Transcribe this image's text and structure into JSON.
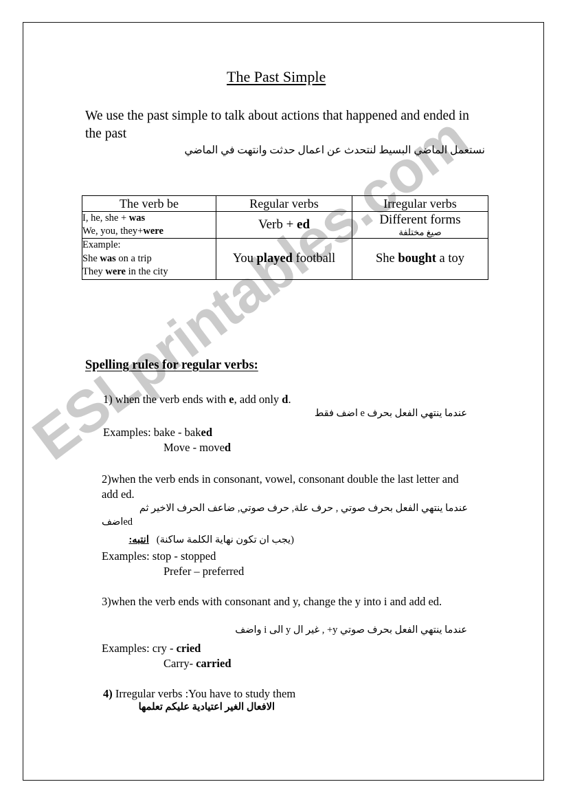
{
  "document": {
    "title": "The Past Simple",
    "intro_en": "We use the past simple to talk about actions that happened and ended in the past",
    "intro_ar": "نستعمل الماضي البسيط لنتحدث عن اعمال حدثت وانتهت في الماضي"
  },
  "watermark": {
    "text": "ESLprintables.com",
    "color": "#c9c9c9"
  },
  "table": {
    "headers": {
      "col1": "The verb be",
      "col2": "Regular verbs",
      "col3": "Irregular verbs"
    },
    "row_forms": {
      "col1_line1_plain": "I, he, she + ",
      "col1_line1_bold": "was",
      "col1_line2_plain": "We, you, they+",
      "col1_line2_bold": "were",
      "col2_plain": "Verb + ",
      "col2_bold": "ed",
      "col3_en": "Different forms",
      "col3_ar": "صيغ مختلفة"
    },
    "row_examples": {
      "col1_label": "Example:",
      "col1_line1_a": "She ",
      "col1_line1_bold": "was",
      "col1_line1_b": " on a trip",
      "col1_line2_a": "They ",
      "col1_line2_bold": "were",
      "col1_line2_b": " in the city",
      "col2_a": "You ",
      "col2_bold": "played",
      "col2_b": " football",
      "col3_a": "She ",
      "col3_bold": "bought",
      "col3_b": " a toy"
    }
  },
  "rules_section": {
    "heading": "Spelling rules for regular verbs:",
    "rule1": {
      "number": "1)",
      "text_a": "  when the verb ends with ",
      "bold_1": "e",
      "text_b": ", add only ",
      "bold_2": "d",
      "text_c": ".",
      "arabic": "عندما ينتهي الفعل بحرف e اضف فقط",
      "examples_label": "Examples:",
      "example1_a": "  bake   -  bak",
      "example1_bold": "ed",
      "example2_a": "Move  -  move",
      "example2_bold": "d"
    },
    "rule2": {
      "number": "2)",
      "text": "when the verb ends in consonant, vowel, consonant double the last letter and add ed.",
      "arabic_line1": "عندما ينتهي الفعل بحرف صوتي , حرف علة, حرف صوتي, ضاعف الحرف الاخير ثم",
      "arabic_line2_ar": "اضف",
      "arabic_line2_en": "ed",
      "note_label": "انتبه:",
      "note_text": "(يجب ان تكون نهاية الكلمة ساكنة)",
      "examples_label": "Examples:",
      "example1": "  stop  -  stopped",
      "example2": "Prefer – preferred"
    },
    "rule3": {
      "number": "3)",
      "text": "when the verb ends with consonant and y, change the y into i and add ed.",
      "arabic": "عندما ينتهي الفعل بحرف صوتي y+ ,  غير ال y الى i واضف",
      "examples_label": "Examples:",
      "example1_a": " cry    -  ",
      "example1_bold": "cried",
      "example2_a": "Carry- ",
      "example2_bold": "carried"
    },
    "rule4": {
      "number": "4)",
      "text": " Irregular verbs :You have to study them",
      "arabic": "الافعال الغير اعتيادية عليكم تعلمها"
    }
  }
}
